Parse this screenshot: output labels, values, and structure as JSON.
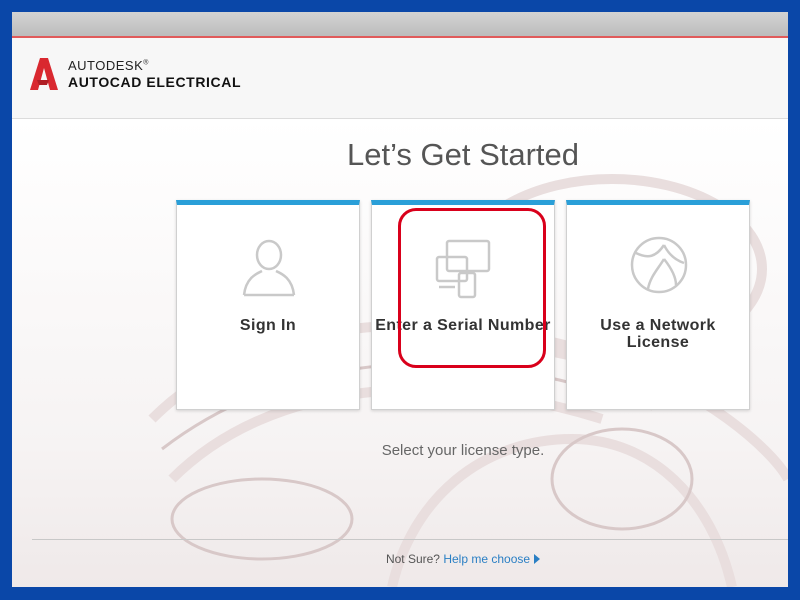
{
  "header": {
    "brand": "AUTODESK",
    "product": "AUTOCAD ELECTRICAL",
    "registered_mark": "®"
  },
  "main": {
    "title": "Let’s Get Started",
    "subtitle": "Select your license type.",
    "cards": [
      {
        "label": "Sign In",
        "icon": "user-icon"
      },
      {
        "label": "Enter a Serial Number",
        "icon": "devices-icon",
        "highlighted": true
      },
      {
        "label": "Use a Network License",
        "icon": "globe-icon"
      }
    ]
  },
  "footer": {
    "prefix": "Not Sure?",
    "link": "Help me choose"
  },
  "colors": {
    "card_accent": "#2a9fd8",
    "highlight": "#d9001b",
    "link": "#2a7fc4",
    "frame": "#0a47a8"
  }
}
